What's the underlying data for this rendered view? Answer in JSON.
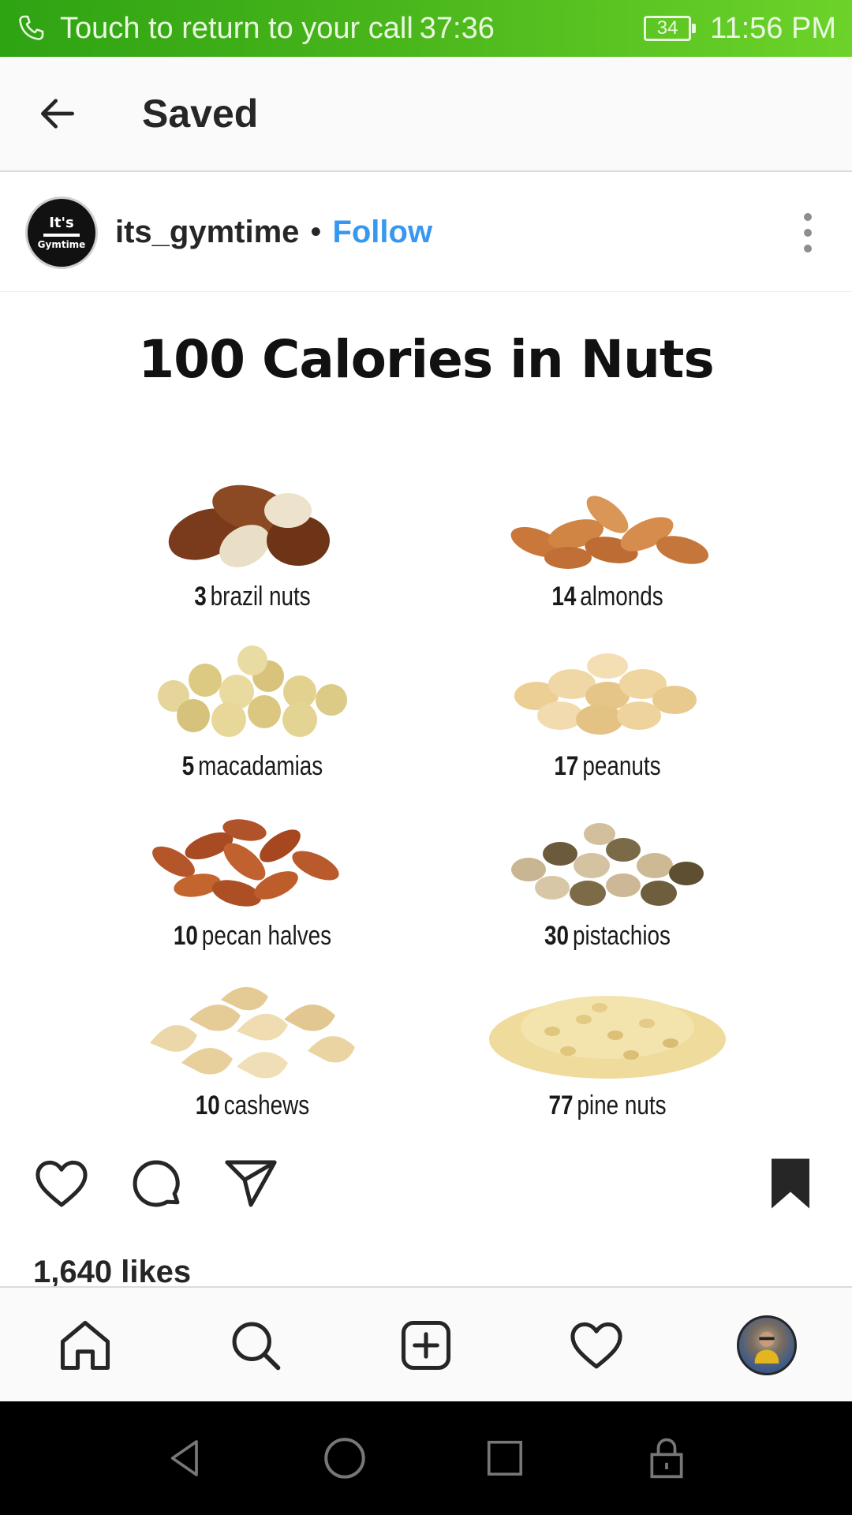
{
  "status_bar": {
    "call_text": "Touch to return to your call",
    "call_timer": "37:36",
    "battery": "34",
    "time": "11:56 PM"
  },
  "header": {
    "title": "Saved",
    "back_icon": "arrow-left-icon"
  },
  "post": {
    "username": "its_gymtime",
    "separator": "•",
    "follow_label": "Follow",
    "avatar_logo_top": "It's",
    "avatar_logo_bottom": "Gymtime",
    "image": {
      "headline": "100 Calories in Nuts",
      "items": [
        {
          "count": "3",
          "name": "brazil nuts"
        },
        {
          "count": "14",
          "name": "almonds"
        },
        {
          "count": "5",
          "name": "macadamias"
        },
        {
          "count": "17",
          "name": "peanuts"
        },
        {
          "count": "10",
          "name": "pecan halves"
        },
        {
          "count": "30",
          "name": "pistachios"
        },
        {
          "count": "10",
          "name": "cashews"
        },
        {
          "count": "77",
          "name": "pine nuts"
        }
      ]
    },
    "likes": "1,640 likes"
  },
  "actions": {
    "like_icon": "heart-icon",
    "comment_icon": "comment-icon",
    "share_icon": "send-icon",
    "save_icon": "bookmark-filled-icon"
  },
  "bottom_nav": [
    "home-icon",
    "search-icon",
    "add-post-icon",
    "activity-heart-icon",
    "profile-avatar"
  ],
  "system_nav": [
    "back-triangle-icon",
    "home-circle-icon",
    "recents-square-icon",
    "lock-icon"
  ],
  "colors": {
    "status_bar_green": "#3fae17",
    "follow_blue": "#3897f0",
    "text": "#262626"
  }
}
